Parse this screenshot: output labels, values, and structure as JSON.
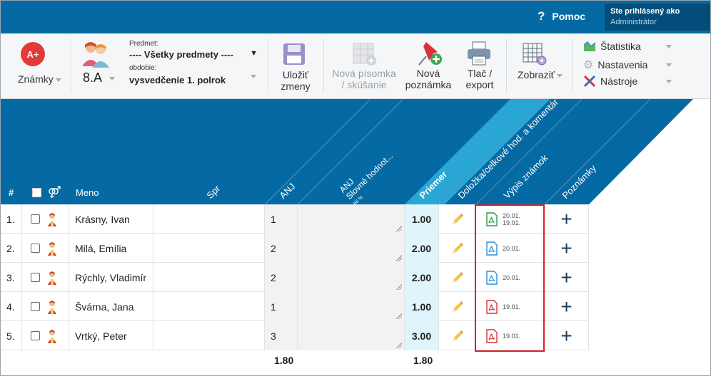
{
  "topbar": {
    "help_icon": "question-mark-icon",
    "help_label": "Pomoc",
    "login_title": "Ste prihlásený ako",
    "login_user": "Administrátor"
  },
  "toolbar": {
    "grades_label": "Známky",
    "class_label": "8.A",
    "subject_caption": "Predmet:",
    "subject_value": "---- Všetky predmety ----",
    "period_caption": "obdobie:",
    "period_value": "vysvedčenie 1. polrok",
    "save_label_1": "Uložiť",
    "save_label_2": "zmeny",
    "new_test_1": "Nová písomka",
    "new_test_2": "/ skúšanie",
    "new_note_1": "Nová",
    "new_note_2": "poznámka",
    "print_1": "Tlač /",
    "print_2": "export",
    "view_label": "Zobraziť",
    "statistics": "Štatistika",
    "settings": "Nastavenia",
    "tools": "Nástroje"
  },
  "header": {
    "num": "#",
    "gender_icon": "gender-icon",
    "name": "Meno",
    "spr": "Spr",
    "anj": "ANJ",
    "slov_1": "ANJ",
    "slov_2": "Slovné hodnot...",
    "slov_3": "66 %",
    "priemer": "Priemer",
    "dolozka": "Doložka/celkové hod. a komentár",
    "vypis": "Výpis známok",
    "poznamky": "Poznámky"
  },
  "rows": [
    {
      "num": "1.",
      "name": "Krásny, Ivan",
      "anj": "1",
      "avg": "1.00",
      "pdf_color": "#2e9c4a",
      "date1": "20.01.",
      "date2": "19.01."
    },
    {
      "num": "2.",
      "name": "Milá, Emília",
      "anj": "2",
      "avg": "2.00",
      "pdf_color": "#2a8fd8",
      "date1": "20.01.",
      "date2": ""
    },
    {
      "num": "3.",
      "name": "Rýchly, Vladimír",
      "anj": "2",
      "avg": "2.00",
      "pdf_color": "#2a8fd8",
      "date1": "20.01.",
      "date2": ""
    },
    {
      "num": "4.",
      "name": "Švárna, Jana",
      "anj": "1",
      "avg": "1.00",
      "pdf_color": "#d8333b",
      "date1": "19.01.",
      "date2": ""
    },
    {
      "num": "5.",
      "name": "Vrtký, Peter",
      "anj": "3",
      "avg": "3.00",
      "pdf_color": "#d8333b",
      "date1": "19.01.",
      "date2": ""
    }
  ],
  "footer": {
    "anj_avg": "1.80",
    "priemer_avg": "1.80"
  },
  "colors": {
    "brand_blue": "#056aa3",
    "header_dark": "#056aa3",
    "priemer_band": "#29a6d4",
    "highlight_red": "#d8202a"
  }
}
